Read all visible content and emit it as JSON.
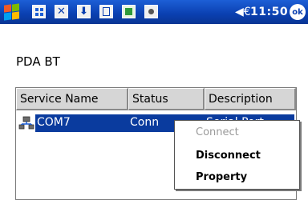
{
  "status_bar": {
    "icons": [
      "start-flag-icon",
      "app-grid-icon",
      "close-box-icon",
      "download-icon",
      "clipboard-icon",
      "image-icon",
      "camera-icon"
    ],
    "volume_icon": "◀€",
    "time": "11:50",
    "ok_label": "ok"
  },
  "device": {
    "name": "PDA BT"
  },
  "list": {
    "columns": [
      "Service Name",
      "Status",
      "Description"
    ],
    "rows": [
      {
        "name": "COM7",
        "status": "Conn",
        "description": "Serial Port"
      }
    ]
  },
  "context_menu": {
    "items": [
      {
        "label": "Connect",
        "enabled": false
      },
      {
        "label": "Disconnect",
        "enabled": true
      },
      {
        "label": "Property",
        "enabled": true
      }
    ]
  },
  "colors": {
    "titlebar": "#0a3fb0",
    "selection": "#0a3b9e",
    "disabled_text": "#9a9a9a"
  }
}
